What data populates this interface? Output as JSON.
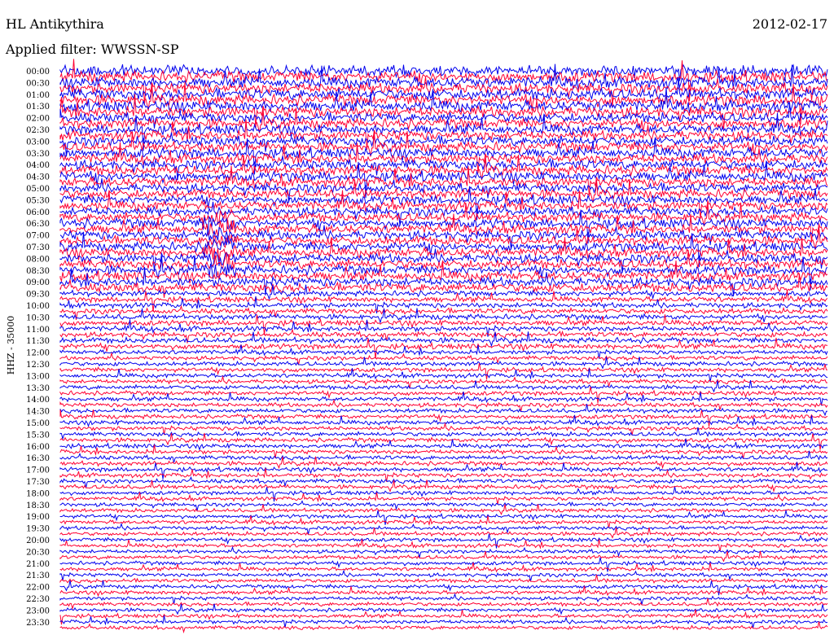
{
  "header": {
    "station": "HL Antikythira",
    "date": "2012-02-17",
    "filter_text": "Applied filter: WWSSN-SP"
  },
  "channel_label": "HHZ - 35000",
  "colors": {
    "trace_a": "#0000ee",
    "trace_b": "#ff0033",
    "background": "#ffffff",
    "text": "#000000"
  },
  "chart_data": {
    "type": "line",
    "subtype": "helicorder",
    "row_duration_minutes": 15,
    "row_colors_cycle": [
      "blue",
      "red"
    ],
    "tick_labels": [
      "00:00",
      "00:30",
      "01:00",
      "01:30",
      "02:00",
      "02:30",
      "03:00",
      "03:30",
      "04:00",
      "04:30",
      "05:00",
      "05:30",
      "06:00",
      "06:30",
      "07:00",
      "07:30",
      "08:00",
      "08:30",
      "09:00",
      "09:30",
      "10:00",
      "10:30",
      "11:00",
      "11:30",
      "12:00",
      "12:30",
      "13:00",
      "13:30",
      "14:00",
      "14:30",
      "15:00",
      "15:30",
      "16:00",
      "16:30",
      "17:00",
      "17:30",
      "18:00",
      "18:30",
      "19:00",
      "19:30",
      "20:00",
      "20:30",
      "21:00",
      "21:30",
      "22:00",
      "22:30",
      "23:00",
      "23:30"
    ],
    "grid": false,
    "legend": "none",
    "notes": "Continuous seismogram traces; high-amplitude noise early in the day (00:00-09:30), a large saturated event around 06:30-08:30 near the start of the rows, lower background amplitude after 10:00."
  }
}
